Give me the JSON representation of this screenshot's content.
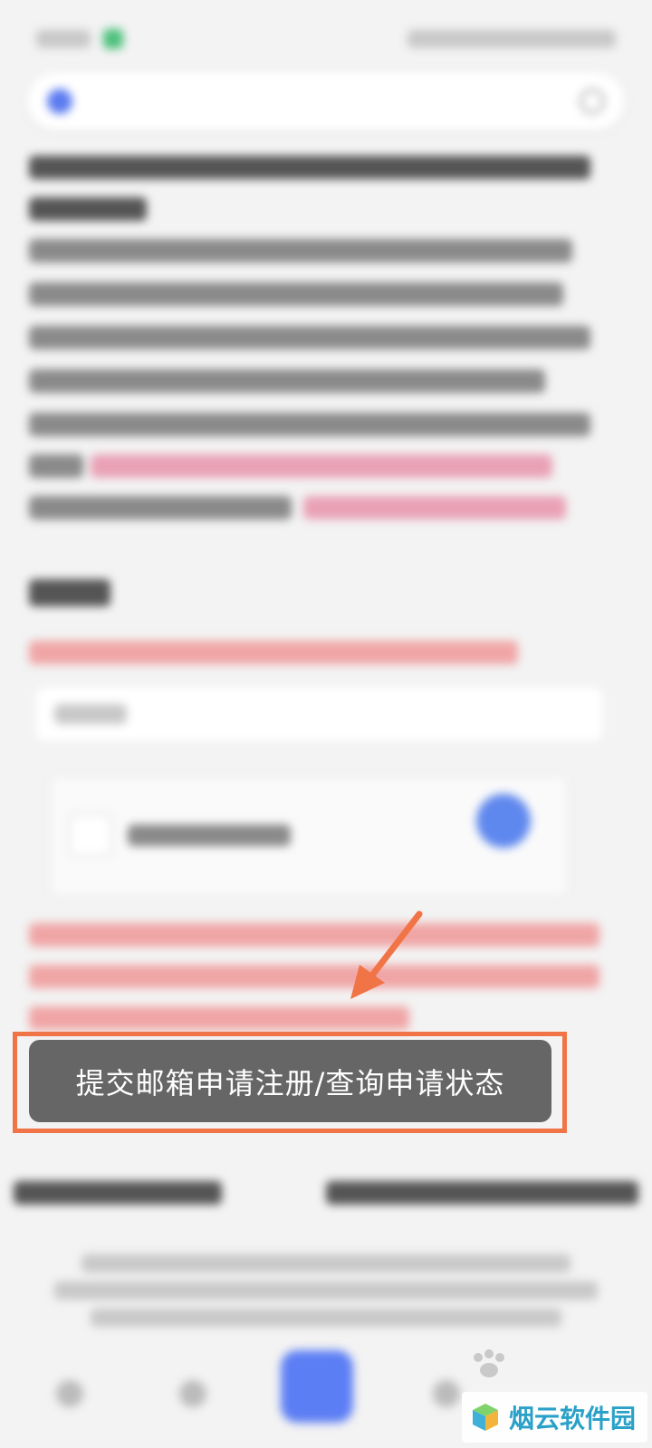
{
  "toast": {
    "message": "提交邮箱申请注册/查询申请状态"
  },
  "watermark": {
    "text": "烟云软件园",
    "icon": "cube-logo-icon"
  },
  "colors": {
    "highlight": "#f07445",
    "toast_bg": "#666666",
    "accent_blue": "#5c7ef4"
  },
  "icons": {
    "arrow": "arrow-pointer-icon"
  }
}
